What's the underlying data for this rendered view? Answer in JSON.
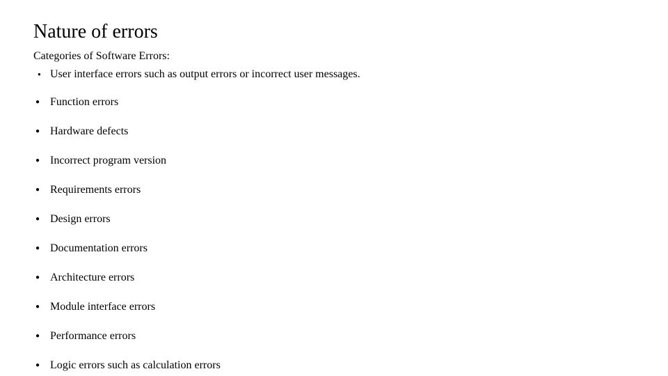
{
  "title": "Nature of errors",
  "subtitle": "Categories of Software Errors:",
  "items": [
    "User interface errors such as output errors or incorrect user messages.",
    "Function errors",
    "Hardware defects",
    "Incorrect program version",
    "Requirements errors",
    "Design errors",
    "Documentation errors",
    "Architecture errors",
    "Module interface errors",
    "Performance errors",
    "Logic errors such as calculation errors"
  ]
}
